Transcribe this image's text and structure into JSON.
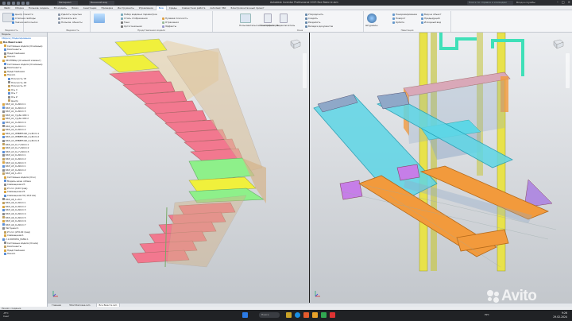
{
  "window": {
    "title": "Autodesk Inventor Professional 2023   Все Вместе.iam",
    "search_placeholder": "Поиск по справке и командам",
    "user": "Вход в службы",
    "file_selector": "Материал",
    "appearance_selector": "Внешний вид"
  },
  "tabs": [
    "Файл",
    "Сборка",
    "Пользов. модель",
    "3D-модель",
    "Эскиз",
    "Аннотации",
    "Проверка",
    "Инструменты",
    "Управление",
    "Вид",
    "Среды",
    "Совместная работа",
    "Autodesk 360",
    "Электромонтажный проект"
  ],
  "active_tab": "Вид",
  "ribbon": {
    "groups": [
      {
        "title": "Видимость",
        "items": [
          "Центр тяжести",
          "Степени свободы",
          "Значки автоссылок",
          "Видимость объектов"
        ]
      },
      {
        "title": "Видимость",
        "items": [
          "Удалить скрытые",
          "Показать все",
          "Пользов. объекты"
        ]
      },
      {
        "title": "Представления модели",
        "items": [
          "Набор видимых параметров",
          "Стиль отображения",
          "Тени",
          "Ортогональная",
          "Нулевая плоскость",
          "Отражения",
          "Эффекты"
        ]
      },
      {
        "title": "Окна",
        "items": [
          "Пользовательский интерфейс",
          "Очистить экран",
          "Переключатель",
          "Упорядочить",
          "Создать",
          "Разделить",
          "Вкладки документов",
          "Упорядочить окна"
        ]
      },
      {
        "title": "Навигация",
        "items": [
          "Панорамирование",
          "Поворот",
          "Орбита",
          "Штурвалы",
          "Вид на объект",
          "Предыдущий",
          "Исходный вид"
        ]
      }
    ]
  },
  "browser": {
    "header": "Модель",
    "subheader": "Сборка | Моделирование",
    "root": "Все Вместе.iam",
    "rows": [
      "Системные модели (Основные)",
      "Компоненты",
      "Представления",
      "Начало",
      "ЛЕСТНИЦА (Основной элемент)",
      "Системные модели (Основные)",
      "Компоненты",
      "Представления",
      "Начало",
      "Плоскость YZ",
      "Плоскость XZ",
      "Плоскость XY",
      "Ось X",
      "Ось Y",
      "Ось Z",
      "Центр",
      "БКЛ_А1_0+8mm:1",
      "БКЛ_А1_0+8mm:2",
      "БКЛ_А1_0+8mm:3",
      "БКЛ_А1_труба 4Х0:1",
      "БКЛ_А1_труба 4Х0:2",
      "БКЛ_А1_0+8mm:4",
      "БКЛ_А2_0+8mm:1",
      "БКЛ_А2_0+8mm:2",
      "БКЛ_А3_ЛЕВЕРТАЖ_0+8mm:1",
      "БКЛ_А3_ЛЕВЕРТАЖ_0+8mm:2",
      "БКЛ_А3_ЛЕВЕРТАЖ_0+8mm:3",
      "БКЛ_А3_0+7+8mm:1",
      "БКЛ_А3_0+7+8mm:2",
      "БКЛ_А3_0+7+8mm:3",
      "БКЛ_А4_0+8mm:1",
      "БКЛ_А4_0+8mm:2",
      "БКЛ_А4_0+8mm:3",
      "БКЛ_А5_0+8mm:1",
      "БКЛ_А5_0+8mm:2",
      "БКЛ_А6_1+8:1",
      "Системные модели (Осн)",
      "Модель ниже собака",
      "Совмещение:23",
      "Угол:1 (0,00 град)",
      "Совмещение:24",
      "Совмещение:32 (18,0 мм)",
      "БКЛ_А6_1+8:2",
      "БКЛ_А6_0+8mm:1",
      "БКЛ_А6_0+8mm:2",
      "БКЛ_А6_0+8mm:3",
      "БКЛ_А6_0+8mm:4",
      "БКЛ_А6_0+8mm:5",
      "БКЛ_А6_0+8mm:6",
      "БКЛ_А6_0+8mm:7",
      "Заглушки:1",
      "Угол:1 (270,00 град)",
      "Совмещение:1",
      "2.1.КОЛОНА_РАМА:1",
      "Системные модели (Основ)",
      "Компоненты",
      "Представления",
      "Начало"
    ]
  },
  "doc_tabs": [
    "Главная",
    "Total Staircase.iam",
    "Все Вместе.iam"
  ],
  "active_doc_tab": "Все Вместе.iam",
  "status": "Режим: создание",
  "taskbar": {
    "weather_temp": "-8°C",
    "weather_text": "Снег",
    "search": "Поиск",
    "lang": "РУС",
    "time": "9:26",
    "date": "29.02.2024"
  },
  "watermark": "Avito",
  "colors": {
    "pink": "#f2788f",
    "yellow": "#f0f03c",
    "green": "#8ef08a",
    "tan": "#d4b48a",
    "cyan": "#5ed6e6",
    "orange": "#f29a3c",
    "purple": "#c67ee8",
    "teal": "#3fe0b8",
    "steel": "#8fa8c8"
  }
}
